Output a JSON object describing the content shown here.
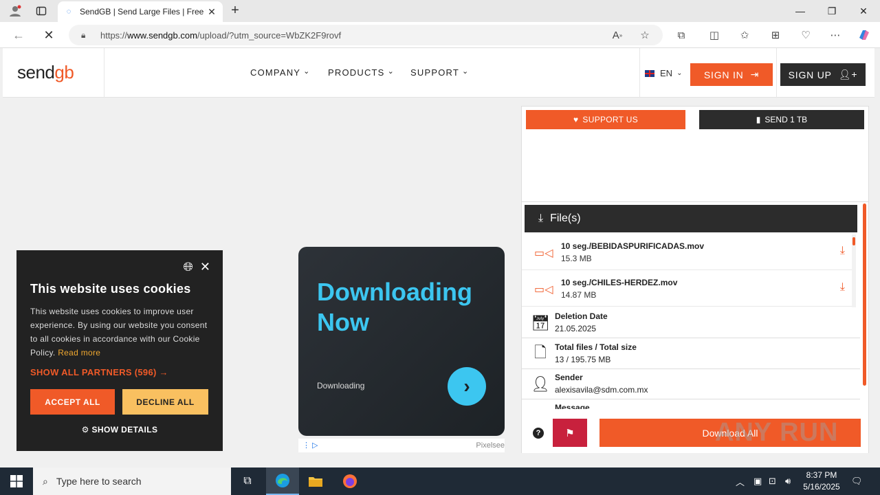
{
  "browser": {
    "tab_title": "SendGB | Send Large Files | Free f",
    "url_prefix": "https://",
    "url_domain": "www.sendgb.com",
    "url_path": "/upload/?utm_source=WbZK2F9rovf"
  },
  "site": {
    "logo_main": "send",
    "logo_accent": "gb",
    "nav": [
      "COMPANY",
      "PRODUCTS",
      "SUPPORT"
    ],
    "language": "EN",
    "sign_in": "SIGN IN",
    "sign_up": "SIGN UP"
  },
  "cookie": {
    "title": "This website uses cookies",
    "body": "This website uses cookies to improve user experience. By using our website you consent to all cookies in accordance with our Cookie Policy.",
    "read_more": "Read more",
    "partners": "SHOW ALL PARTNERS (596) →",
    "accept": "ACCEPT ALL",
    "decline": "DECLINE ALL",
    "details": "SHOW DETAILS"
  },
  "ad": {
    "headline_1": "Downloading",
    "headline_2": "Now",
    "sub": "Downloading",
    "brand": "Pixelsee"
  },
  "panel": {
    "support_us": "SUPPORT US",
    "send_1tb": "SEND 1 TB",
    "files_header": "File(s)",
    "files": [
      {
        "name": "10 seg./BEBIDASPURIFICADAS.mov",
        "size": "15.3 MB"
      },
      {
        "name": "10 seg./CHILES-HERDEZ.mov",
        "size": "14.87 MB"
      }
    ],
    "info": [
      {
        "label": "Deletion Date",
        "value": "21.05.2025"
      },
      {
        "label": "Total files / Total size",
        "value": "13 / 195.75 MB"
      },
      {
        "label": "Sender",
        "value": "alexisavila@sdm.com.mx"
      },
      {
        "label": "Message",
        "value": ""
      }
    ],
    "download_all": "Download All"
  },
  "watermark": "ANY RUN",
  "taskbar": {
    "search_placeholder": "Type here to search",
    "time": "8:37 PM",
    "date": "5/16/2025"
  },
  "colors": {
    "accent": "#f05a28",
    "dark": "#2c2c2c",
    "ad_blue": "#3cc6f0",
    "report_red": "#c8213d"
  }
}
